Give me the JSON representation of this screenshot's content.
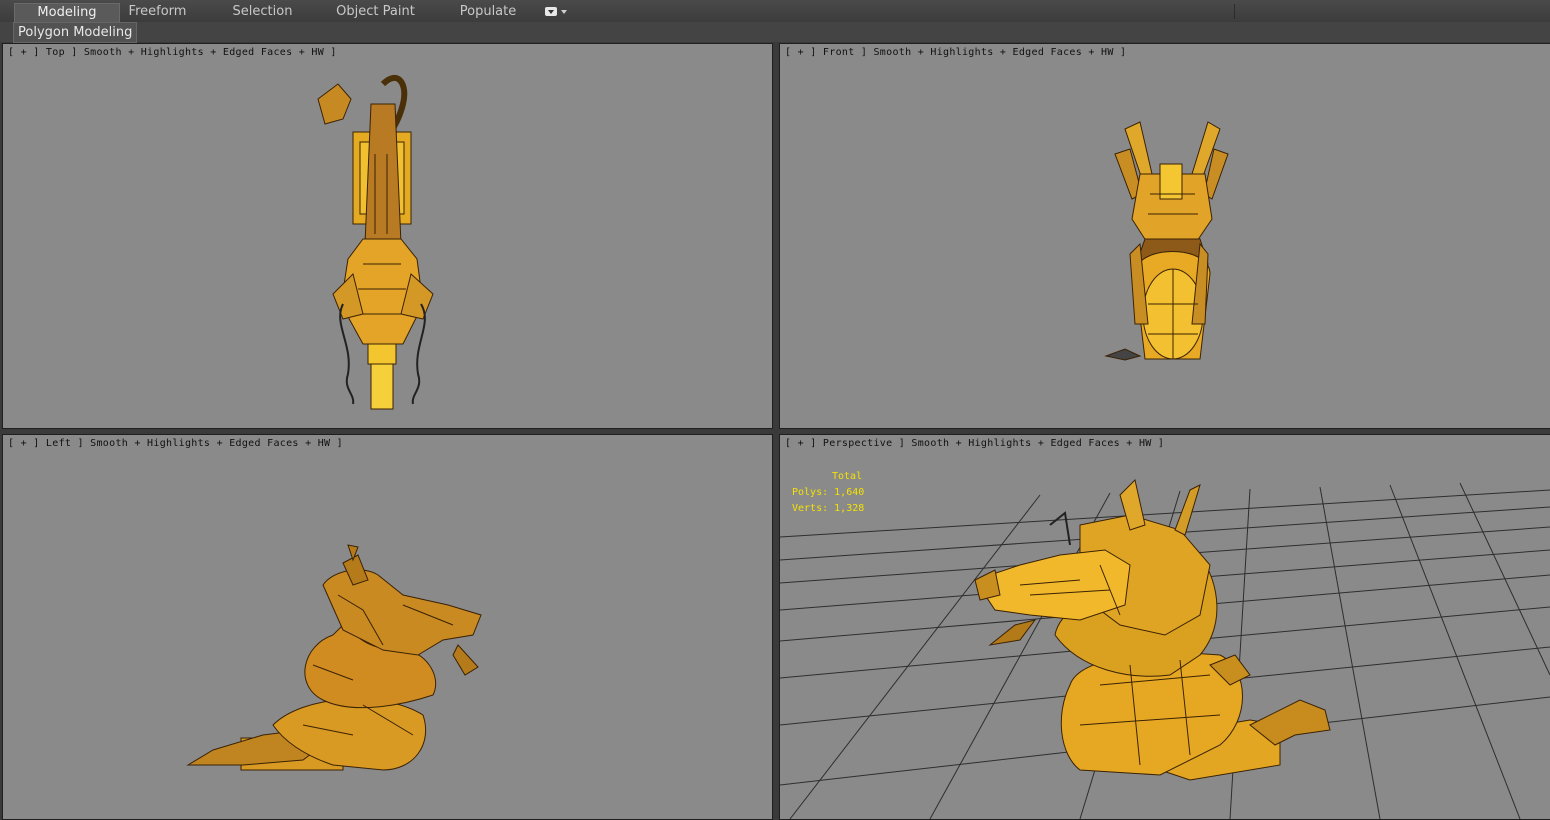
{
  "ribbon": {
    "tabs": [
      "Modeling",
      "Freeform",
      "Selection",
      "Object Paint",
      "Populate"
    ],
    "active_tab": "Modeling",
    "dropdown_icon": "panel-options-icon"
  },
  "subpanel": {
    "label": "Polygon Modeling"
  },
  "viewports": {
    "top": {
      "label": "[ + ] Top ] Smooth + Highlights + Edged Faces + HW ]"
    },
    "front": {
      "label": "[ + ] Front ] Smooth + Highlights + Edged Faces + HW ]"
    },
    "left": {
      "label": "[ + ] Left ] Smooth + Highlights + Edged Faces + HW ]"
    },
    "perspective": {
      "label": "[ + ] Perspective ] Smooth + Highlights + Edged Faces + HW ]"
    }
  },
  "stats": {
    "total_label": "Total",
    "polys_label": "Polys:",
    "polys_value": "1,640",
    "verts_label": "Verts:",
    "verts_value": "1,328"
  },
  "colors": {
    "viewport_bg": "#8a8a8a",
    "model_gold": "#e0a020",
    "model_edge": "#3a2205",
    "stats_text": "#f5e200",
    "grid": "#2e2e2e"
  }
}
